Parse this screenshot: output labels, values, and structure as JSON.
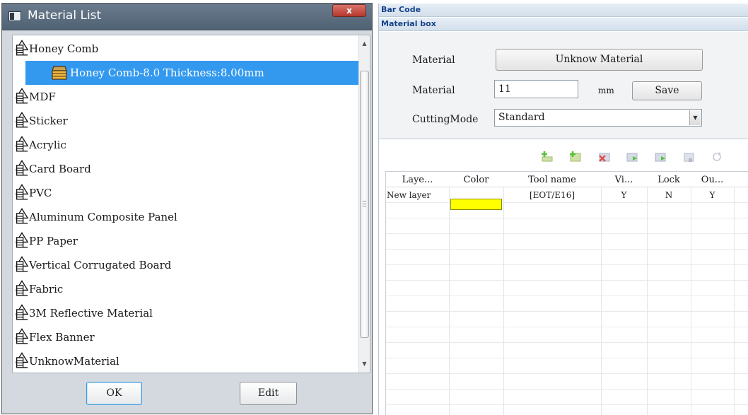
{
  "dialog": {
    "title": "Material List",
    "close_label": "x",
    "ok_label": "OK",
    "edit_label": "Edit",
    "materials": [
      {
        "label": "Honey Comb"
      },
      {
        "label": "Honey Comb-8.0 Thickness:8.00mm",
        "selected": true
      },
      {
        "label": "MDF"
      },
      {
        "label": "Sticker"
      },
      {
        "label": "Acrylic"
      },
      {
        "label": "Card Board"
      },
      {
        "label": "PVC"
      },
      {
        "label": "Aluminum Composite Panel"
      },
      {
        "label": "PP Paper"
      },
      {
        "label": "Vertical Corrugated Board"
      },
      {
        "label": "Fabric"
      },
      {
        "label": "3M Reflective Material"
      },
      {
        "label": "Flex Banner"
      },
      {
        "label": "UnknowMaterial"
      }
    ]
  },
  "right": {
    "bar_code_title": "Bar Code",
    "material_box_title": "Material box",
    "material_label": "Material",
    "material_button": "Unknow Material",
    "thickness_label": "Material",
    "thickness_value": "11",
    "unit": "mm",
    "save_label": "Save",
    "cutting_mode_label": "CuttingMode",
    "cutting_mode_value": "Standard",
    "toolbar_icons": [
      "add-layer-icon",
      "insert-layer-icon",
      "delete-layer-icon",
      "move-up-icon",
      "move-down-icon",
      "copy-layer-icon",
      "refresh-icon"
    ],
    "grid": {
      "columns": [
        "Laye...",
        "Color",
        "Tool name",
        "Vi...",
        "Lock",
        "Ou..."
      ],
      "rows": [
        {
          "layer": "New layer",
          "color": "#ffff00",
          "tool": "[EOT/E16]",
          "visible": "Y",
          "lock": "N",
          "output": "Y"
        }
      ]
    }
  },
  "colors": {
    "selection": "#3399ee",
    "title_bar": "#576a7c",
    "section_header_text": "#15428b",
    "layer_color": "#ffff00"
  }
}
